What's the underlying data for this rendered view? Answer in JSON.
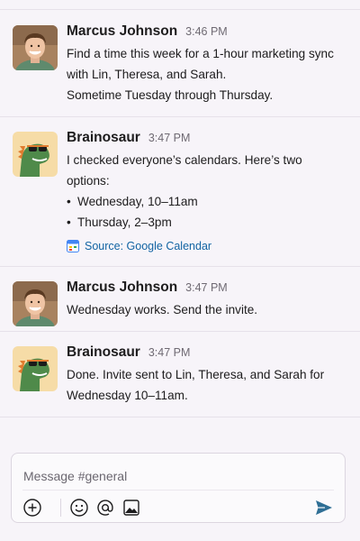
{
  "messages": [
    {
      "sender": "Marcus Johnson",
      "time": "3:46 PM",
      "lines": [
        "Find a time this week for a 1-hour marketing sync",
        "with Lin, Theresa, and Sarah.",
        "Sometime Tuesday through Thursday."
      ]
    },
    {
      "sender": "Brainosaur",
      "time": "3:47 PM",
      "lines": [
        "I checked everyone’s calendars. Here’s two options:"
      ],
      "bullets": [
        "Wednesday, 10–11am",
        "Thursday, 2–3pm"
      ],
      "source": "Source: Google Calendar"
    },
    {
      "sender": "Marcus Johnson",
      "time": "3:47 PM",
      "lines": [
        "Wednesday works. Send the invite."
      ]
    },
    {
      "sender": "Brainosaur",
      "time": "3:47 PM",
      "lines": [
        "Done. Invite sent to Lin, Theresa, and Sarah for",
        "Wednesday 10–11am."
      ]
    }
  ],
  "composer": {
    "placeholder": "Message #general",
    "tools": [
      "plus-icon",
      "emoji-icon",
      "mention-icon",
      "image-icon"
    ],
    "send_icon": "send-icon"
  },
  "colors": {
    "background": "#f7f4f9",
    "link": "#1264a3",
    "send": "#2f6f95"
  }
}
